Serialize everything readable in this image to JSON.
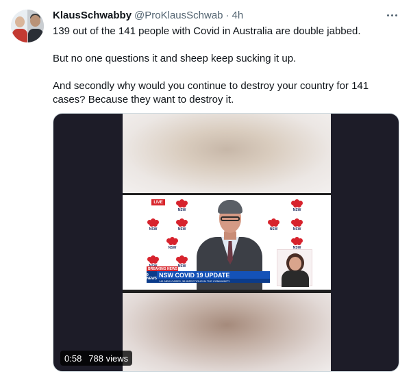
{
  "tweet": {
    "author_name": "KlausSchwabby",
    "handle": "@ProKlausSchwab",
    "separator": "·",
    "time": "4h",
    "paragraphs": [
      "139 out of the 141 people with Covid in Australia are double jabbed.",
      "But no one questions it and sheep keep sucking it up.",
      "And secondly why would you continue to destroy your country for 141 cases?  Because they want to destroy it."
    ]
  },
  "icons": {
    "more": "more-horizontal-icon",
    "logo": "nsw-waratah-logo"
  },
  "video": {
    "live_label": "LIVE",
    "logo_text": "NSW",
    "breaking_label": "BREAKING NEWS",
    "channel_label": "9 NEWS",
    "headline": "NSW COVID 19 UPDATE",
    "subheadline": "141 NEW CASES, 38 INFECTIOUS IN THE COMMUNITY",
    "duration": "0:58",
    "views": "788 views"
  },
  "colors": {
    "text": "#0f1419",
    "secondary": "#536471",
    "nsw_red": "#d7232d",
    "news_blue": "#1452b8",
    "media_bg": "#1d1c28"
  }
}
